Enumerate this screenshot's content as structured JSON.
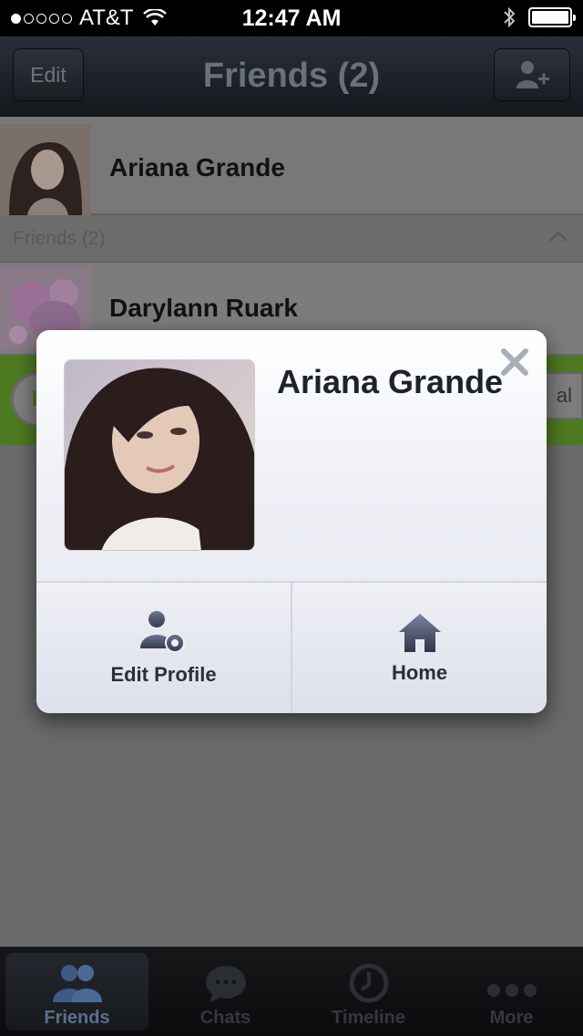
{
  "status_bar": {
    "carrier": "AT&T",
    "time": "12:47 AM",
    "signal_bars_filled": 1,
    "signal_bars_total": 5,
    "battery_level": 1.0
  },
  "nav": {
    "edit_label": "Edit",
    "title": "Friends (2)",
    "add_icon": "add-friend-icon"
  },
  "list": {
    "my_profile_name": "Ariana Grande",
    "section_label": "Friends (2)",
    "friends": [
      {
        "name": "Darylann Ruark"
      }
    ],
    "official_partial": "al"
  },
  "modal": {
    "name": "Ariana Grande",
    "actions": [
      {
        "label": "Edit Profile",
        "icon": "edit-profile-icon"
      },
      {
        "label": "Home",
        "icon": "home-icon"
      }
    ]
  },
  "tabs": [
    {
      "label": "Friends",
      "icon": "friends-icon",
      "active": true
    },
    {
      "label": "Chats",
      "icon": "chats-icon",
      "active": false
    },
    {
      "label": "Timeline",
      "icon": "timeline-icon",
      "active": false
    },
    {
      "label": "More",
      "icon": "more-icon",
      "active": false
    }
  ],
  "colors": {
    "accent_green": "#4e7a22",
    "tab_active": "#5c6f88"
  }
}
